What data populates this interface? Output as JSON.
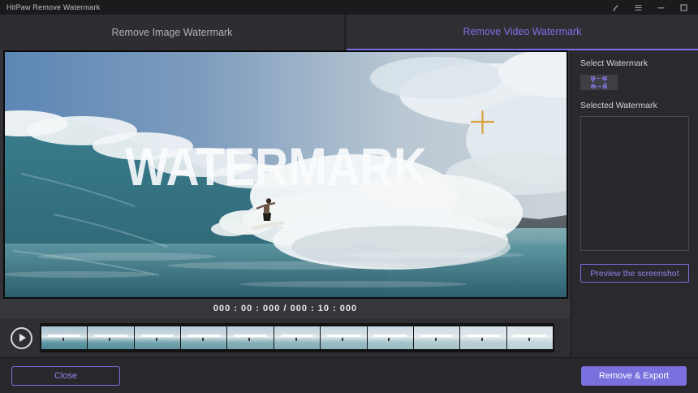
{
  "app": {
    "title": "HitPaw Remove Watermark"
  },
  "titlebar": {
    "icons": [
      "feedback-pen-icon",
      "menu-icon",
      "minimize-icon",
      "maximize-icon"
    ]
  },
  "tabs": [
    {
      "label": "Remove Image Watermark",
      "active": false
    },
    {
      "label": "Remove Video Watermark",
      "active": true
    }
  ],
  "video": {
    "watermark_text": "WATERMARK",
    "timecode": "000 : 00 : 000 / 000 : 10 : 000",
    "thumbnail_count": 11,
    "icons": [
      "play-icon",
      "crosshair-cursor-icon"
    ]
  },
  "panel": {
    "select_watermark_label": "Select Watermark",
    "marquee_icon": "marquee-selection-icon",
    "selected_watermark_label": "Selected Watermark",
    "preview_button_label": "Preview the screenshot"
  },
  "footer": {
    "close_button_label": "Close",
    "export_button_label": "Remove & Export"
  },
  "colors": {
    "accent": "#7b6fe4",
    "accent_text": "#8e84ec",
    "export_button_fill": "#7a70dd",
    "crosshair": "#db9e37",
    "active_tab_text": "#7d71e8"
  }
}
